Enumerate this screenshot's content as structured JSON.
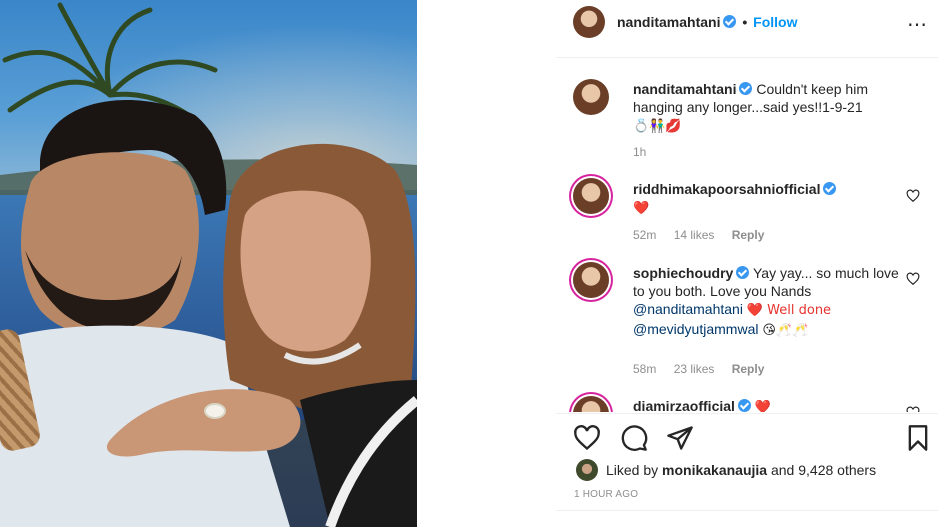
{
  "post": {
    "author": {
      "username": "nanditamahtani",
      "follow_separator": "•",
      "follow_label": "Follow",
      "more_icon": "⋯"
    },
    "caption": {
      "username": "nanditamahtani",
      "text": "Couldn't keep him hanging any longer...said yes!!1-9-21",
      "emojis": "💍👫💋",
      "time": "1h"
    },
    "comments": [
      {
        "username": "riddhimakapoorsahniofficial",
        "text": "❤️",
        "time": "52m",
        "likes": "14 likes",
        "reply": "Reply"
      },
      {
        "username": "sophiechoudry",
        "text_part1": "Yay yay... so much love to you both. Love you Nands",
        "mention1": "@nanditamahtani",
        "text_part2": "❤️ Well done",
        "mention2": "@mevidyutjammwal",
        "emojis": "😘🥂🥂",
        "time": "58m",
        "likes": "23 likes",
        "reply": "Reply"
      },
      {
        "username": "diamirzaofficial",
        "text": "❤️"
      }
    ],
    "actions": {
      "like_icon": "heart-outline",
      "comment_icon": "speech-bubble",
      "share_icon": "paper-plane",
      "save_icon": "bookmark"
    },
    "liked_by": {
      "prefix": "Liked by",
      "user": "monikakanaujia",
      "suffix": "and 9,428 others"
    },
    "posted": "1 HOUR AGO"
  },
  "colors": {
    "accent": "#0095f6",
    "verified": "#3897f0",
    "heart": "#e5322d",
    "muted": "#8e8e8e"
  }
}
